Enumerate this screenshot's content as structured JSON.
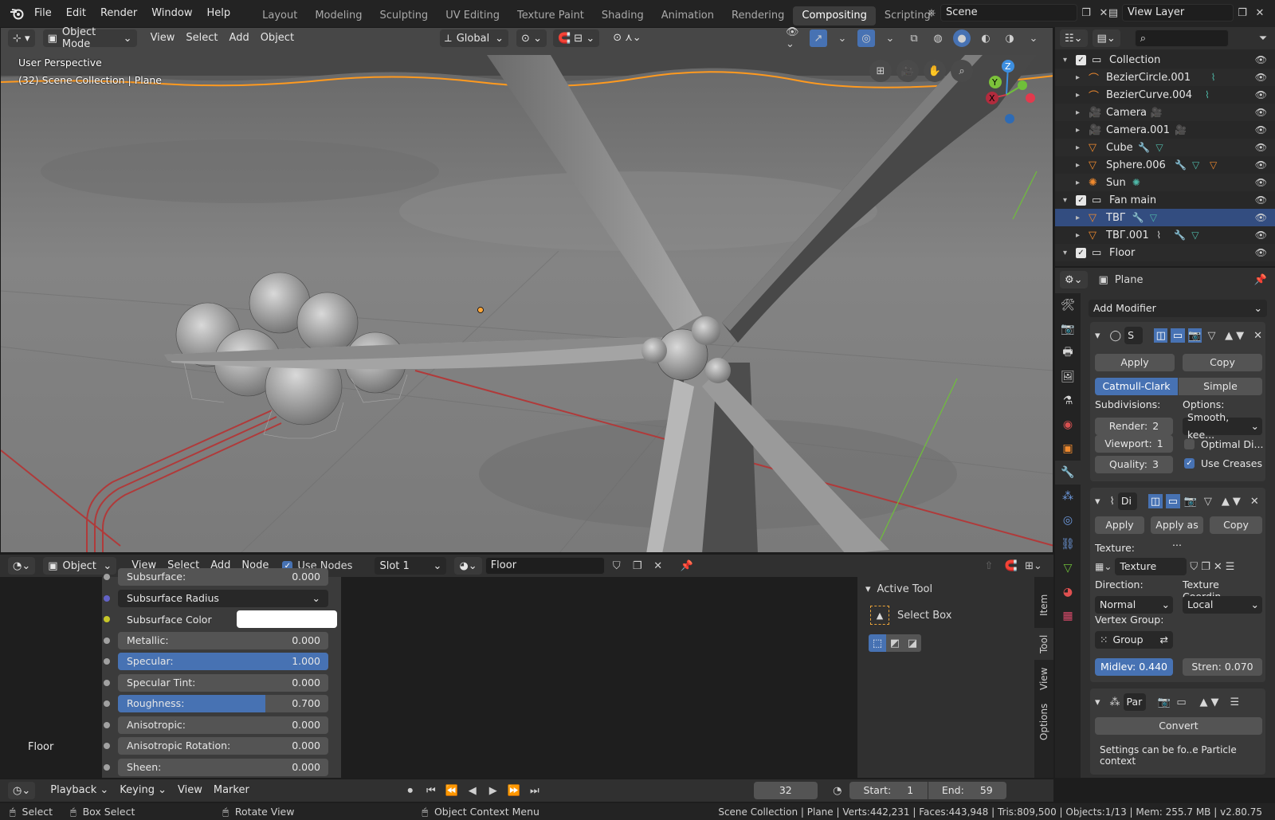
{
  "menu": {
    "items": [
      "File",
      "Edit",
      "Render",
      "Window",
      "Help"
    ]
  },
  "workspaces": {
    "tabs": [
      "Layout",
      "Modeling",
      "Sculpting",
      "UV Editing",
      "Texture Paint",
      "Shading",
      "Animation",
      "Rendering",
      "Compositing",
      "Scripting"
    ],
    "active": "Compositing",
    "add": "+"
  },
  "scene": {
    "name": "Scene"
  },
  "view_layer": {
    "name": "View Layer"
  },
  "viewport": {
    "mode": "Object Mode",
    "menus": [
      "View",
      "Select",
      "Add",
      "Object"
    ],
    "orientation": "Global",
    "perspective": "User Perspective",
    "collection_info": "(32) Scene Collection | Plane",
    "gizmo": {
      "z": "Z",
      "y": "Y",
      "x": "X"
    }
  },
  "outliner": {
    "search_placeholder": "",
    "rows": [
      {
        "name": "Collection",
        "type": "collection",
        "indent": 0,
        "checked": true
      },
      {
        "name": "BezierCircle.001",
        "type": "curve",
        "indent": 1
      },
      {
        "name": "BezierCurve.004",
        "type": "curve",
        "indent": 1
      },
      {
        "name": "Camera",
        "type": "camera",
        "indent": 1
      },
      {
        "name": "Camera.001",
        "type": "camera",
        "indent": 1
      },
      {
        "name": "Cube",
        "type": "mesh",
        "indent": 1
      },
      {
        "name": "Sphere.006",
        "type": "mesh",
        "indent": 1
      },
      {
        "name": "Sun",
        "type": "light",
        "indent": 1
      },
      {
        "name": "Fan main",
        "type": "collection",
        "indent": 0,
        "checked": true
      },
      {
        "name": "ТВГ",
        "type": "mesh",
        "indent": 1,
        "selected": true
      },
      {
        "name": "ТВГ.001",
        "type": "mesh",
        "indent": 1
      },
      {
        "name": "Floor",
        "type": "collection",
        "indent": 0,
        "checked": true
      }
    ]
  },
  "properties": {
    "object_name": "Plane",
    "add_modifier": "Add Modifier",
    "subsurf": {
      "name": "S",
      "apply": "Apply",
      "copy": "Copy",
      "catmull": "Catmull-Clark",
      "simple": "Simple",
      "subdivisions_label": "Subdivisions:",
      "options_label": "Options:",
      "render_label": "Render:",
      "render_value": "2",
      "viewport_label": "Viewport:",
      "viewport_value": "1",
      "quality_label": "Quality:",
      "quality_value": "3",
      "smooth": "Smooth, kee...",
      "optimal": "Optimal Di...",
      "optimal_checked": false,
      "use_creases": "Use Creases",
      "use_creases_checked": true
    },
    "displace": {
      "name": "Di",
      "apply": "Apply",
      "apply_as": "Apply as ...",
      "copy": "Copy",
      "texture_label": "Texture:",
      "texture_value": "Texture",
      "direction_label": "Direction:",
      "direction_value": "Normal",
      "texcoord_label": "Texture Coordin...",
      "texcoord_value": "Local",
      "vgroup_label": "Vertex Group:",
      "vgroup_value": "Group",
      "midlevel": "Midlev: 0.440",
      "strength": "Stren: 0.070"
    },
    "particle": {
      "name": "Par",
      "convert": "Convert",
      "note": "Settings can be fo..e Particle context"
    }
  },
  "node_editor": {
    "type": "Object",
    "menus": [
      "View",
      "Select",
      "Add",
      "Node"
    ],
    "use_nodes_label": "Use Nodes",
    "use_nodes": true,
    "slot": "Slot 1",
    "material": "Floor",
    "frame_label": "Floor",
    "rows": [
      {
        "label": "Subsurface:",
        "value": "0.000",
        "fill": 0
      },
      {
        "label": "Subsurface Radius",
        "dropdown": true
      },
      {
        "label": "Subsurface Color",
        "color": "#ffffff"
      },
      {
        "label": "Metallic:",
        "value": "0.000",
        "fill": 0
      },
      {
        "label": "Specular:",
        "value": "1.000",
        "fill": 1.0
      },
      {
        "label": "Specular Tint:",
        "value": "0.000",
        "fill": 0
      },
      {
        "label": "Roughness:",
        "value": "0.700",
        "fill": 0.7
      },
      {
        "label": "Anisotropic:",
        "value": "0.000",
        "fill": 0
      },
      {
        "label": "Anisotropic Rotation:",
        "value": "0.000",
        "fill": 0
      },
      {
        "label": "Sheen:",
        "value": "0.000",
        "fill": 0
      }
    ],
    "active_tool": {
      "title": "Active Tool",
      "tool": "Select Box"
    },
    "side_tabs": [
      "Item",
      "Tool",
      "View",
      "Options"
    ]
  },
  "timeline": {
    "menus": [
      "Playback",
      "Keying",
      "View",
      "Marker"
    ],
    "current_frame": "32",
    "start_label": "Start:",
    "start": "1",
    "end_label": "End:",
    "end": "59"
  },
  "statusbar": {
    "select": "Select",
    "box_select": "Box Select",
    "rotate": "Rotate View",
    "context_menu": "Object Context Menu",
    "stats": "Scene Collection | Plane | Verts:442,231 | Faces:443,948 | Tris:809,500 | Objects:1/13 | Mem: 255.7 MB | v2.80.75"
  },
  "colors": {
    "accent": "#4772b3",
    "selection_row": "#334d80",
    "viewport_bg": "#5b5b5b",
    "horizon_orange": "#ff9a1f"
  }
}
